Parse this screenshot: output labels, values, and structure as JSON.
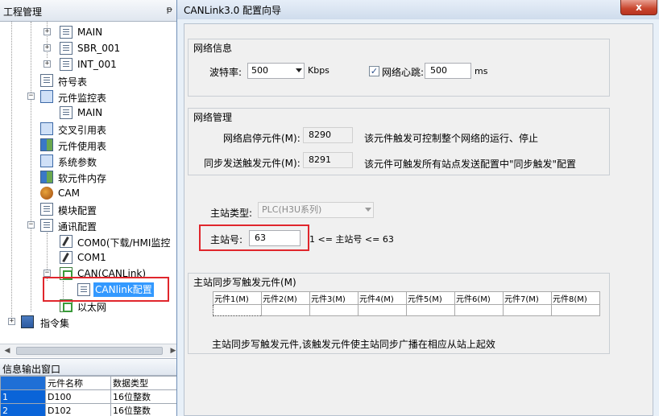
{
  "project_panel": {
    "title": "工程管理",
    "pin_glyph": "ᵽ",
    "tree": [
      {
        "label": "MAIN",
        "icon": "doc-icon"
      },
      {
        "label": "SBR_001",
        "icon": "doc-icon"
      },
      {
        "label": "INT_001",
        "icon": "doc-icon"
      },
      {
        "label": "符号表",
        "icon": "symbol-table-icon"
      },
      {
        "label": "元件监控表",
        "icon": "monitor-table-icon"
      },
      {
        "label": "MAIN",
        "icon": "doc-icon"
      },
      {
        "label": "交叉引用表",
        "icon": "cross-ref-icon"
      },
      {
        "label": "元件使用表",
        "icon": "usage-table-icon"
      },
      {
        "label": "系统参数",
        "icon": "system-param-icon"
      },
      {
        "label": "软元件内存",
        "icon": "device-memory-icon"
      },
      {
        "label": "CAM",
        "icon": "cam-icon"
      },
      {
        "label": "模块配置",
        "icon": "module-config-icon"
      },
      {
        "label": "通讯配置",
        "icon": "comm-config-icon"
      },
      {
        "label": "COM0(下载/HMI监控",
        "icon": "pen-icon"
      },
      {
        "label": "COM1",
        "icon": "pen-icon"
      },
      {
        "label": "CAN(CANLink)",
        "icon": "network-icon"
      },
      {
        "label": "CANlink配置",
        "icon": "doc-icon"
      },
      {
        "label": "以太网",
        "icon": "network-icon"
      },
      {
        "label": "指令集",
        "icon": "instruction-set-icon"
      }
    ]
  },
  "info_panel": {
    "title": "信息输出窗口",
    "columns": [
      "",
      "元件名称",
      "数据类型"
    ],
    "rows": [
      [
        "1",
        "D100",
        "16位整数"
      ],
      [
        "2",
        "D102",
        "16位整数"
      ]
    ]
  },
  "dialog": {
    "title": "CANLink3.0 配置向导",
    "close_glyph": "x",
    "network_info": {
      "group_title": "网络信息",
      "baud_label": "波特率:",
      "baud_value": "500",
      "baud_unit": "Kbps",
      "heartbeat_checked": "✓",
      "heartbeat_label": "网络心跳:",
      "heartbeat_value": "500",
      "heartbeat_unit": "ms"
    },
    "network_mgmt": {
      "group_title": "网络管理",
      "start_stop_label": "网络启停元件(M):",
      "start_stop_value": "8290",
      "start_stop_desc": "该元件触发可控制整个网络的运行、停止",
      "sync_label": "同步发送触发元件(M):",
      "sync_value": "8291",
      "sync_desc": "该元件可触发所有站点发送配置中\"同步触发\"配置"
    },
    "master": {
      "type_label": "主站类型:",
      "type_value": "PLC(H3U系列)",
      "number_label": "主站号:",
      "number_value": "63",
      "number_range": "1 <= 主站号 <= 63"
    },
    "sync_write": {
      "group_title": "主站同步写触发元件(M)",
      "columns": [
        "元件1(M)",
        "元件2(M)",
        "元件3(M)",
        "元件4(M)",
        "元件5(M)",
        "元件6(M)",
        "元件7(M)",
        "元件8(M)"
      ],
      "footer": "主站同步写触发元件,该触发元件使主站同步广播在相应从站上起效"
    }
  },
  "colors": {
    "highlight_red": "#e0262c",
    "selection_blue": "#3399ff",
    "close_red": "#c8452d"
  }
}
